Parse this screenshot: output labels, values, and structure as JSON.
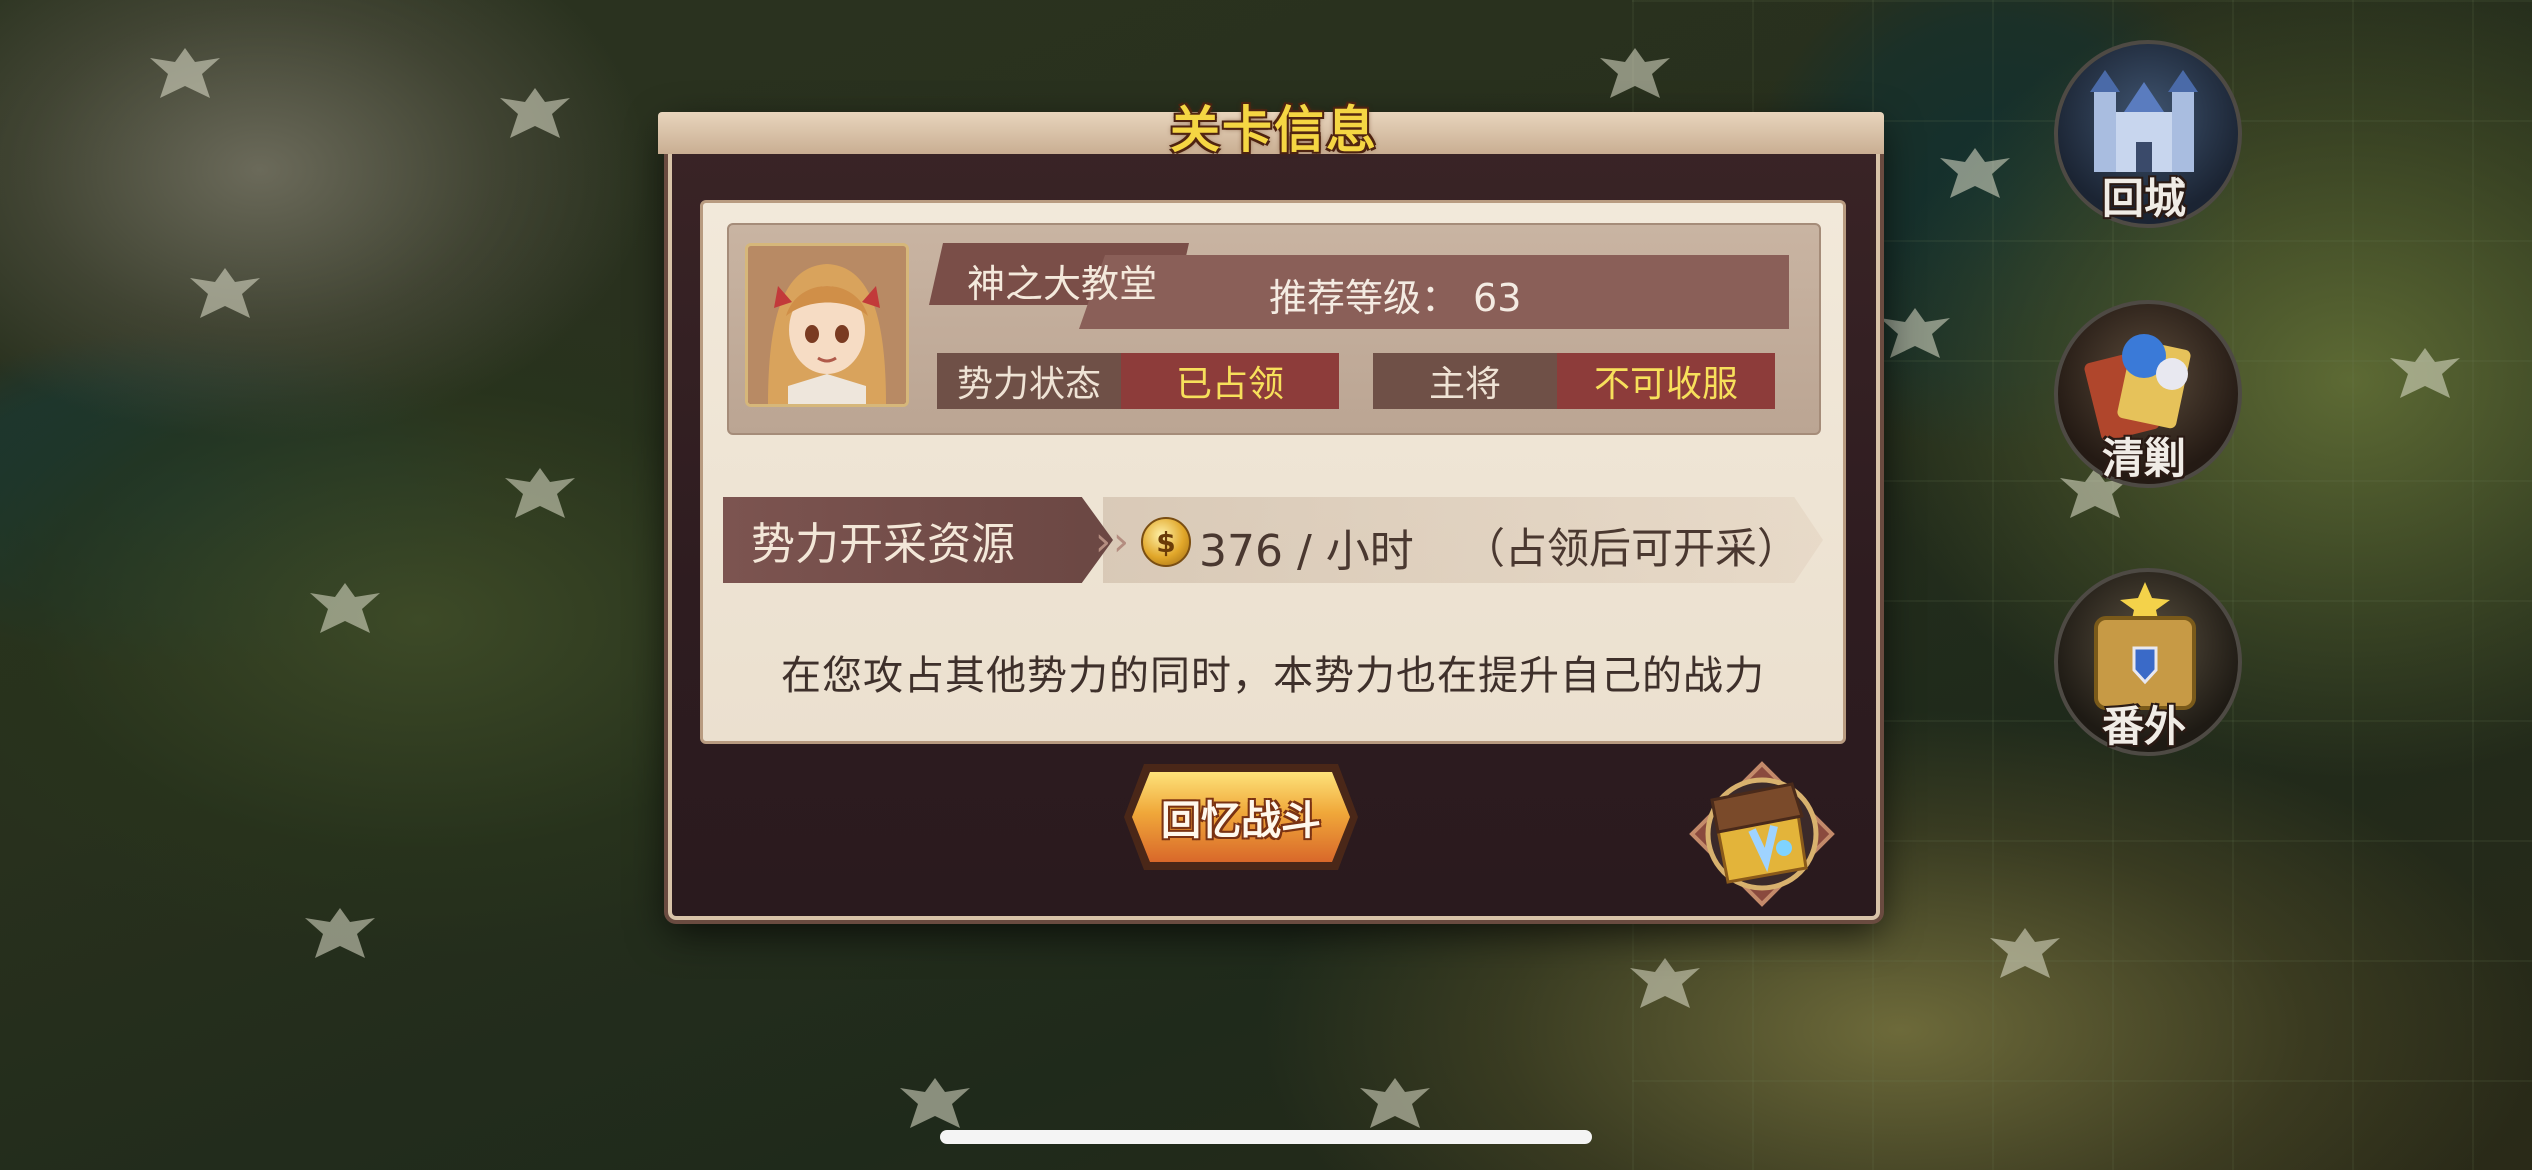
{
  "dialog": {
    "title": "关卡信息",
    "stage_name": "神之大教堂",
    "recommended_level_label": "推荐等级：",
    "recommended_level_value": "63",
    "faction_status_label": "势力状态",
    "faction_status_value": "已占领",
    "general_label": "主将",
    "general_value": "不可收服",
    "resource_label": "势力开采资源",
    "resource_rate": "376 / 小时",
    "resource_note": "（占领后可开采）",
    "description": "在您攻占其他势力的同时，本势力也在提升自己的战力",
    "recall_button": "回忆战斗",
    "chest_icon": "treasure-chest-icon",
    "coin_icon": "coin-icon",
    "coin_symbol": "$"
  },
  "side_buttons": [
    {
      "label": "回城",
      "icon": "castle-icon"
    },
    {
      "label": "清剿",
      "icon": "cards-icon"
    },
    {
      "label": "番外",
      "icon": "scroll-icon"
    }
  ],
  "colors": {
    "title": "#f5d643",
    "status_value": "#f7e05b",
    "status_value_bg": "#8d3c3a",
    "button_gradient_top": "#fde27a",
    "button_gradient_bottom": "#d9682a"
  }
}
